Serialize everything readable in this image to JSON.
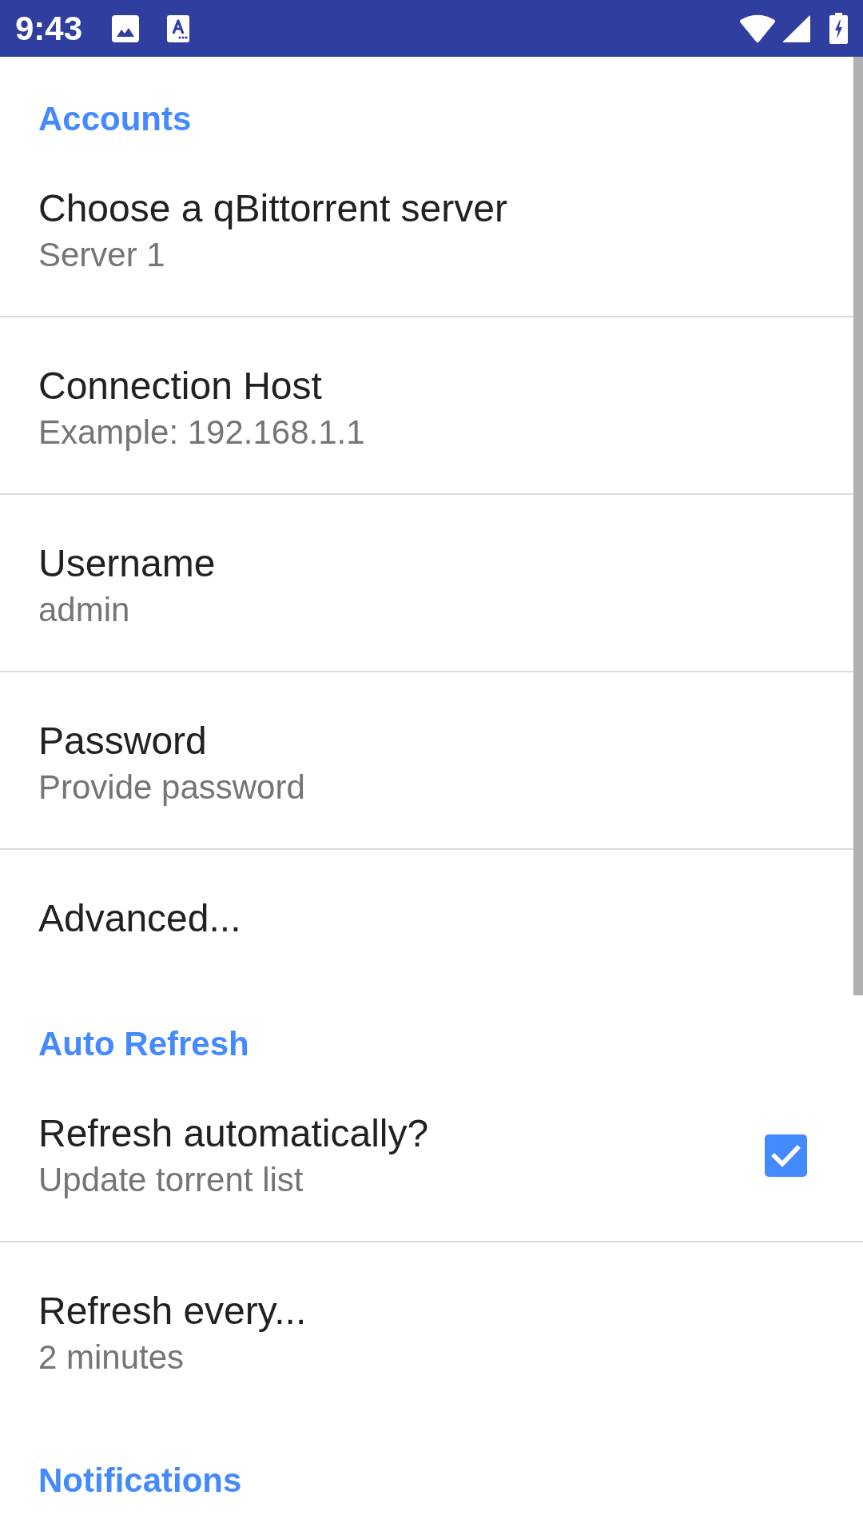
{
  "status_bar": {
    "time": "9:43"
  },
  "sections": [
    {
      "title": "Accounts",
      "items": [
        {
          "kind": "plain",
          "title": "Choose a qBittorrent server",
          "summary": "Server 1"
        },
        {
          "kind": "plain",
          "title": "Connection Host",
          "summary": "Example: 192.168.1.1"
        },
        {
          "kind": "plain",
          "title": "Username",
          "summary": "admin"
        },
        {
          "kind": "plain",
          "title": "Password",
          "summary": "Provide password"
        },
        {
          "kind": "plain",
          "title": "Advanced..."
        }
      ]
    },
    {
      "title": "Auto Refresh",
      "items": [
        {
          "kind": "checkbox",
          "title": "Refresh automatically?",
          "summary": "Update torrent list",
          "checked": true
        },
        {
          "kind": "plain",
          "title": "Refresh every...",
          "summary": "2 minutes"
        }
      ]
    },
    {
      "title": "Notifications"
    }
  ]
}
